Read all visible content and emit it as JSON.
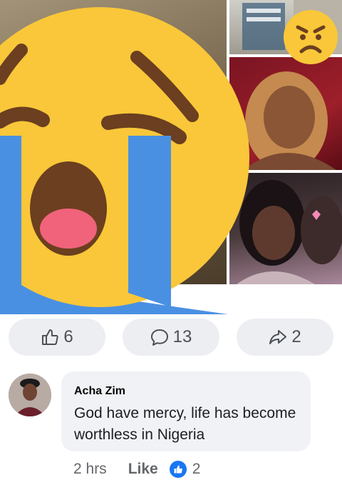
{
  "post": {
    "images": [
      {
        "name": "crying-emoji-photo"
      },
      {
        "name": "poster-photo"
      },
      {
        "name": "woman-portrait-photo"
      },
      {
        "name": "couple-selfie-photo"
      }
    ],
    "overlay_icons": [
      "crying-face-emoji",
      "angry-face-emoji"
    ],
    "stats": {
      "likes": "6",
      "comments": "13",
      "shares": "2"
    }
  },
  "comment": {
    "author": "Acha Zim",
    "text": "God have mercy, life has become worthless in Nigeria",
    "time": "2 hrs",
    "like_label": "Like",
    "reaction_count": "2"
  },
  "colors": {
    "emoji_yellow": "#f9c739",
    "tear_blue": "#4a90e2",
    "pill_bg": "#eceef2",
    "bubble_bg": "#f0f2f5",
    "like_blue": "#1877f2"
  }
}
